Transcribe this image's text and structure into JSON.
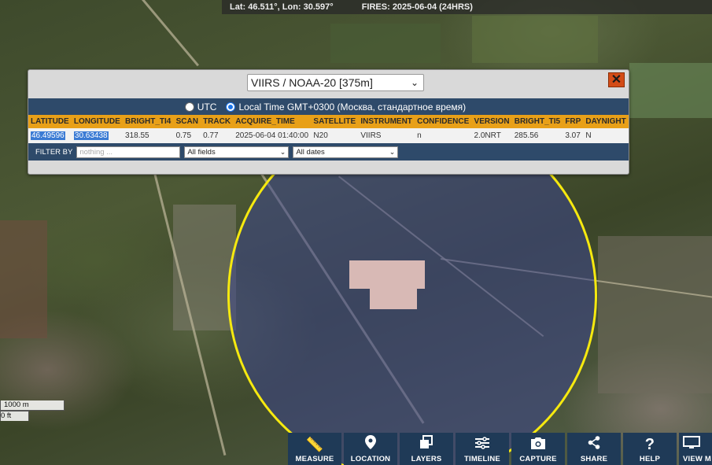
{
  "status": {
    "coords": "Lat: 46.511°, Lon: 30.597°",
    "fires": "FIRES: 2025-06-04 (24HRS)"
  },
  "popup": {
    "sensor": "VIIRS / NOAA-20 [375m]",
    "close": "✕",
    "time_mode": {
      "utc_label": "UTC",
      "local_label": "Local Time GMT+0300 (Москва, стандартное время)",
      "selected": "local"
    },
    "columns": [
      "LATITUDE",
      "LONGITUDE",
      "BRIGHT_TI4",
      "SCAN",
      "TRACK",
      "ACQUIRE_TIME",
      "SATELLITE",
      "INSTRUMENT",
      "CONFIDENCE",
      "VERSION",
      "BRIGHT_TI5",
      "FRP",
      "DAYNIGHT"
    ],
    "row": {
      "latitude": "46.49596",
      "longitude": "30.63438",
      "bright_ti4": "318.55",
      "scan": "0.75",
      "track": "0.77",
      "acquire_time": "2025-06-04 01:40:00",
      "satellite": "N20",
      "instrument": "VIIRS",
      "confidence": "n",
      "version": "2.0NRT",
      "bright_ti5": "285.56",
      "frp": "3.07",
      "daynight": "N"
    },
    "filter": {
      "label": "FILTER BY",
      "placeholder": "nothing ...",
      "fields_value": "All fields",
      "dates_value": "All dates"
    }
  },
  "scale": {
    "metric": "1000 m",
    "imperial": "0 ft"
  },
  "toolbar": [
    {
      "label": "MEASURE",
      "icon": "ruler-icon"
    },
    {
      "label": "LOCATION",
      "icon": "pin-icon"
    },
    {
      "label": "LAYERS",
      "icon": "layers-icon"
    },
    {
      "label": "TIMELINE",
      "icon": "sliders-icon"
    },
    {
      "label": "CAPTURE",
      "icon": "camera-icon"
    },
    {
      "label": "SHARE",
      "icon": "share-icon"
    },
    {
      "label": "HELP",
      "icon": "help-icon"
    },
    {
      "label": "VIEW M",
      "icon": "monitor-icon"
    }
  ],
  "colors": {
    "header_orange": "#e8a018",
    "panel_blue": "#2e4a6a",
    "fire_circle": "#f6e90f",
    "close_red": "#d34c17",
    "toolbar_bg": "#1f3a57"
  }
}
